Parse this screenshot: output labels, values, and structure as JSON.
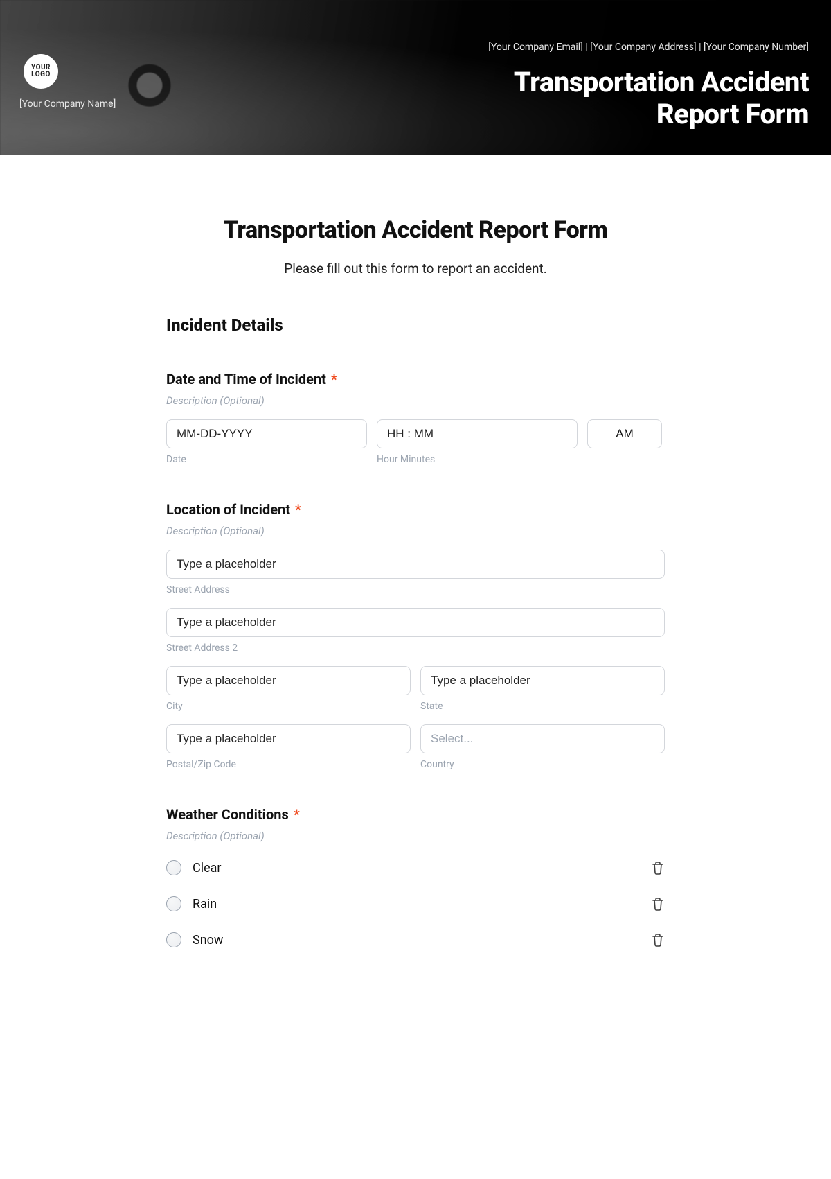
{
  "hero": {
    "logo_line1": "YOUR",
    "logo_line2": "LOGO",
    "company_name": "[Your Company Name]",
    "meta": "[Your Company Email] | [Your Company Address] | [Your Company Number]",
    "title_line1": "Transportation Accident",
    "title_line2": "Report Form"
  },
  "form": {
    "title": "Transportation Accident Report Form",
    "subtitle": "Please fill out this form to report an accident.",
    "section1": "Incident Details",
    "datetime": {
      "label": "Date and Time of Incident",
      "desc": "Description (Optional)",
      "date_placeholder": "MM-DD-YYYY",
      "time_placeholder": "HH : MM",
      "ampm_value": "AM",
      "date_sub": "Date",
      "time_sub": "Hour Minutes"
    },
    "location": {
      "label": "Location of Incident",
      "desc": "Description (Optional)",
      "street1_placeholder": "Type a placeholder",
      "street1_sub": "Street Address",
      "street2_placeholder": "Type a placeholder",
      "street2_sub": "Street Address 2",
      "city_placeholder": "Type a placeholder",
      "city_sub": "City",
      "state_placeholder": "Type a placeholder",
      "state_sub": "State",
      "postal_placeholder": "Type a placeholder",
      "postal_sub": "Postal/Zip Code",
      "country_placeholder": "Select...",
      "country_sub": "Country"
    },
    "weather": {
      "label": "Weather Conditions",
      "desc": "Description (Optional)",
      "options": [
        "Clear",
        "Rain",
        "Snow"
      ]
    }
  }
}
